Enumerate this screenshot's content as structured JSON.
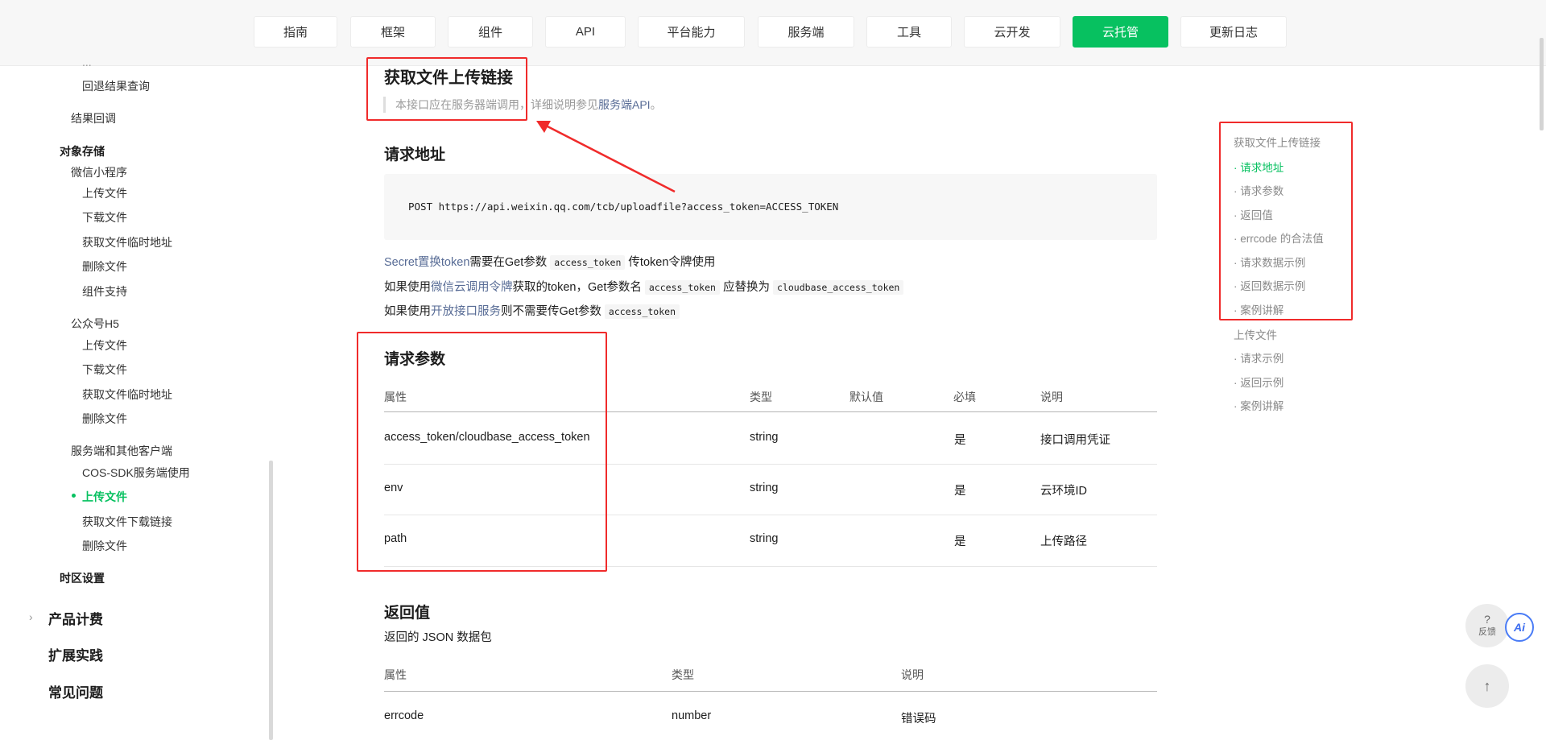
{
  "nav": {
    "items": [
      "指南",
      "框架",
      "组件",
      "API",
      "平台能力",
      "服务端",
      "工具",
      "云开发",
      "云托管",
      "更新日志"
    ],
    "active": "云托管"
  },
  "sidebar": {
    "partial_top": "...",
    "items": [
      "回退结果查询",
      "结果回调",
      "对象存储",
      "微信小程序",
      "上传文件",
      "下载文件",
      "获取文件临时地址",
      "删除文件",
      "组件支持",
      "公众号H5",
      "上传文件",
      "下载文件",
      "获取文件临时地址",
      "删除文件",
      "服务端和其他客户端",
      "COS-SDK服务端使用",
      "上传文件",
      "获取文件下载链接",
      "删除文件",
      "时区设置",
      "产品计费",
      "扩展实践",
      "常见问题"
    ]
  },
  "main": {
    "title": "获取文件上传链接",
    "note_prefix": "本接口应在服务器端调用，详细说明参见",
    "note_link": "服务端API",
    "note_suffix": "。",
    "request_url_title": "请求地址",
    "request_url": "POST https://api.weixin.qq.com/tcb/uploadfile?access_token=ACCESS_TOKEN",
    "line1": {
      "link": "Secret置换token",
      "mid": "需要在Get参数",
      "code": "access_token",
      "suffix": "传token令牌使用"
    },
    "line2": {
      "prefix": "如果使用",
      "link": "微信云调用令牌",
      "mid": "获取的token，Get参数名",
      "code1": "access_token",
      "mid2": "应替换为",
      "code2": "cloudbase_access_token"
    },
    "line3": {
      "prefix": "如果使用",
      "link": "开放接口服务",
      "mid": "则不需要传Get参数",
      "code": "access_token"
    },
    "params_title": "请求参数",
    "params_headers": [
      "属性",
      "类型",
      "默认值",
      "必填",
      "说明"
    ],
    "params_rows": [
      {
        "name": "access_token/cloudbase_access_token",
        "type": "string",
        "default": "",
        "required": "是",
        "desc": "接口调用凭证",
        "desc_is_link": true
      },
      {
        "name": "env",
        "type": "string",
        "default": "",
        "required": "是",
        "desc": "云环境ID",
        "desc_is_link": false
      },
      {
        "name": "path",
        "type": "string",
        "default": "",
        "required": "是",
        "desc": "上传路径",
        "desc_is_link": false
      }
    ],
    "return_title": "返回值",
    "return_subtitle": "返回的 JSON 数据包",
    "return_headers": [
      "属性",
      "类型",
      "说明"
    ],
    "return_rows": [
      {
        "name": "errcode",
        "type": "number",
        "desc": "错误码"
      }
    ]
  },
  "toc": {
    "items": [
      "获取文件上传链接",
      "· 请求地址",
      "· 请求参数",
      "· 返回值",
      "· errcode 的合法值",
      "· 请求数据示例",
      "· 返回数据示例",
      "· 案例讲解",
      "上传文件",
      "· 请求示例",
      "· 返回示例",
      "· 案例讲解"
    ],
    "active_index": 1
  },
  "floating": {
    "feedback_icon": "?",
    "feedback_label": "反馈",
    "ai_label": "Ai",
    "top_icon": "↑"
  },
  "colors": {
    "accent": "#07c160",
    "link": "#576b95",
    "annotation": "#f02b2b"
  }
}
